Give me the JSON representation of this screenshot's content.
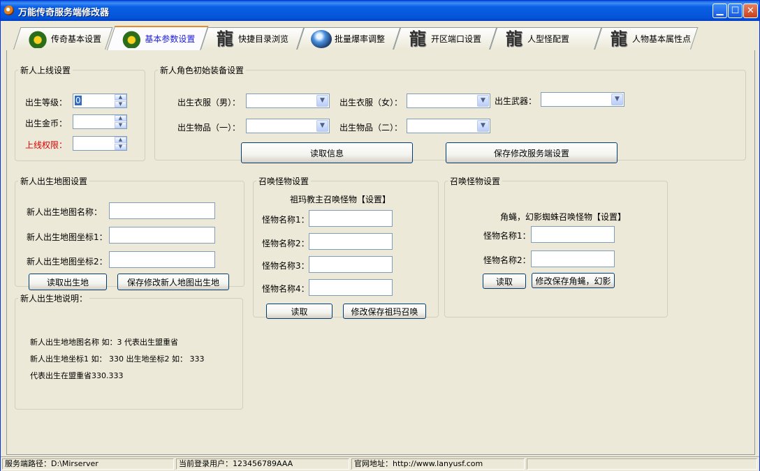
{
  "window": {
    "title": "万能传奇服务端修改器"
  },
  "tabs": [
    {
      "label": "传奇基本设置",
      "icon": "warrior-icon"
    },
    {
      "label": "基本参数设置",
      "icon": "warrior-icon"
    },
    {
      "label": "快捷目录浏览",
      "icon": "dragon-icon"
    },
    {
      "label": "批量爆率调整",
      "icon": "globe-icon"
    },
    {
      "label": "开区端口设置",
      "icon": "dragon-icon"
    },
    {
      "label": "人型怪配置",
      "icon": "dragon-icon"
    },
    {
      "label": "人物基本属性点",
      "icon": "dragon-icon"
    }
  ],
  "newbie_online": {
    "legend": "新人上线设置",
    "level_label": "出生等级：",
    "level_value": "0",
    "gold_label": "出生金币：",
    "perm_label": "上线权限："
  },
  "equipment": {
    "legend": "新人角色初始装备设置",
    "cloth_m_label": "出生衣服（男）：",
    "cloth_f_label": "出生衣服（女）：",
    "weapon_label": "出生武器：",
    "item1_label": "出生物品（一）：",
    "item2_label": "出生物品（二）：",
    "read_button": "读取信息",
    "save_button": "保存修改服务端设置"
  },
  "birth_map": {
    "legend": "新人出生地图设置",
    "name_label": "新人出生地图名称：",
    "coord1_label": "新人出生地图坐标1：",
    "coord2_label": "新人出生地图坐标2：",
    "read_button": "读取出生地",
    "save_button": "保存修改新人地图出生地"
  },
  "summon_zuma": {
    "legend": "召唤怪物设置",
    "title": "祖玛教主召唤怪物【设置】",
    "name1": "怪物名称1：",
    "name2": "怪物名称2：",
    "name3": "怪物名称3：",
    "name4": "怪物名称4：",
    "read_button": "读取",
    "save_button": "修改保存祖玛召唤"
  },
  "summon_spider": {
    "legend": "召唤怪物设置",
    "title": "角蝇，幻影蜘蛛召唤怪物【设置】",
    "name1": "怪物名称1：",
    "name2": "怪物名称2：",
    "read_button": "读取",
    "save_button": "修改保存角蝇，幻影"
  },
  "birth_note": {
    "legend": "新人出生地说明：",
    "line1": "新人出生地地图名称 如：3 代表出生盟重省",
    "line2": "新人出生地坐标1 如：  330  出生地坐标2 如：  333",
    "line3": "代表出生在盟重省330.333"
  },
  "status": {
    "server_path": "服务端路径：D:\\Mirserver",
    "current_user": "当前登录用户：123456789AAA",
    "website": "官网地址：http://www.lanyusf.com"
  }
}
